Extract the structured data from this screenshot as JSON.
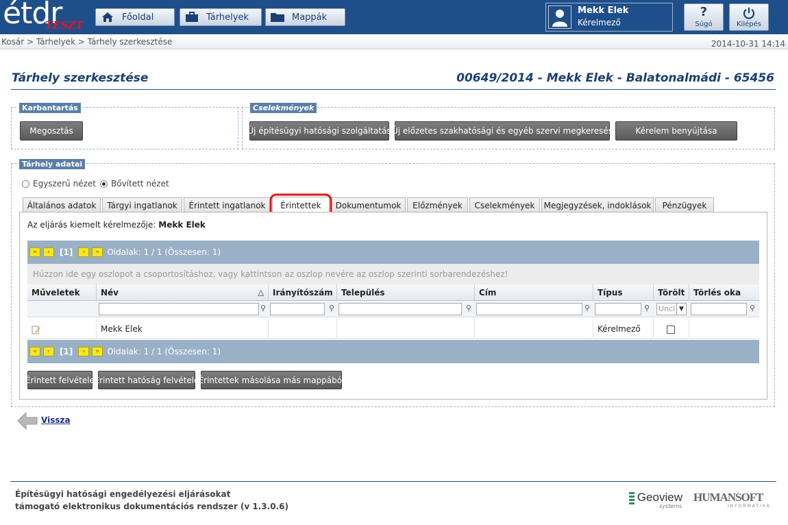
{
  "header": {
    "logo_text": "étdr",
    "logo_badge": "TESZT",
    "nav": [
      {
        "label": "Főoldal"
      },
      {
        "label": "Tárhelyek"
      },
      {
        "label": "Mappák"
      }
    ],
    "user": {
      "name": "Mekk Elek",
      "role": "Kérelmező"
    },
    "help_label": "Súgó",
    "logout_label": "Kilépés"
  },
  "breadcrumb": "Kosár > Tárhelyek > Tárhely szerkesztése",
  "datetime": "2014-10-31 14:14",
  "page": {
    "title": "Tárhely szerkesztése",
    "subtitle": "00649/2014 - Mekk Elek - Balatonalmádi - 65456"
  },
  "karbantartas": {
    "legend": "Karbantartás",
    "share_button": "Megosztás"
  },
  "cselekmenyek": {
    "legend": "Cselekmények",
    "buttons": [
      "Új építésügyi hatósági szolgáltatás",
      "Új előzetes szakhatósági és egyéb szervi megkeresés",
      "Kérelem benyújtása"
    ]
  },
  "tarhely_adatai": {
    "legend": "Tárhely adatai",
    "view_simple": "Egyszerű nézet",
    "view_extended": "Bővített nézet",
    "selected_view": "Bővített nézet",
    "tabs": [
      "Általános adatok",
      "Tárgyi ingatlanok",
      "Érintett ingatlanok",
      "Érintettek",
      "Dokumentumok",
      "Előzmények",
      "Cselekmények",
      "Megjegyzések, indoklások",
      "Pénzügyek"
    ],
    "active_tab": "Érintettek",
    "highlight_color": "#e0151b"
  },
  "grid": {
    "applicant_label": "Az eljárás kiemelt kérelmezője:",
    "applicant_name": "Mekk Elek",
    "pager": {
      "current": "[1]",
      "info": "Oldalak: 1 / 1 (Összesen: 1)"
    },
    "group_hint": "Húzzon ide egy oszlopot a csoportosításhoz, vagy kattintson az oszlop nevére az oszlop szerinti sorbarendezéshez!",
    "columns": [
      "Műveletek",
      "Név",
      "Irányítószám",
      "Település",
      "Cím",
      "Típus",
      "Törölt",
      "Törlés oka"
    ],
    "sort_icon": "sort-ascending-icon",
    "torolt_filter": "Uncl",
    "rows": [
      {
        "nev": "Mekk Elek",
        "iranyitoszam": "",
        "telepules": "",
        "cim": "",
        "tipus": "Kérelmező",
        "torolt": false,
        "torles_oka": ""
      }
    ]
  },
  "actions": [
    "Érintett felvétele",
    "Érintett hatóság felvétele",
    "Érintettek másolása más mappából"
  ],
  "back_link": "Vissza",
  "footer": {
    "line1": "Építésügyi hatósági engedélyezési eljárásokat",
    "line2": "támogató elektronikus dokumentációs rendszer (v 1.3.0.6)",
    "brand1": "Geoview",
    "brand1_sub": "systems",
    "brand2": "HUMANSOFT",
    "brand2_sub": "INFORMATIKA"
  }
}
